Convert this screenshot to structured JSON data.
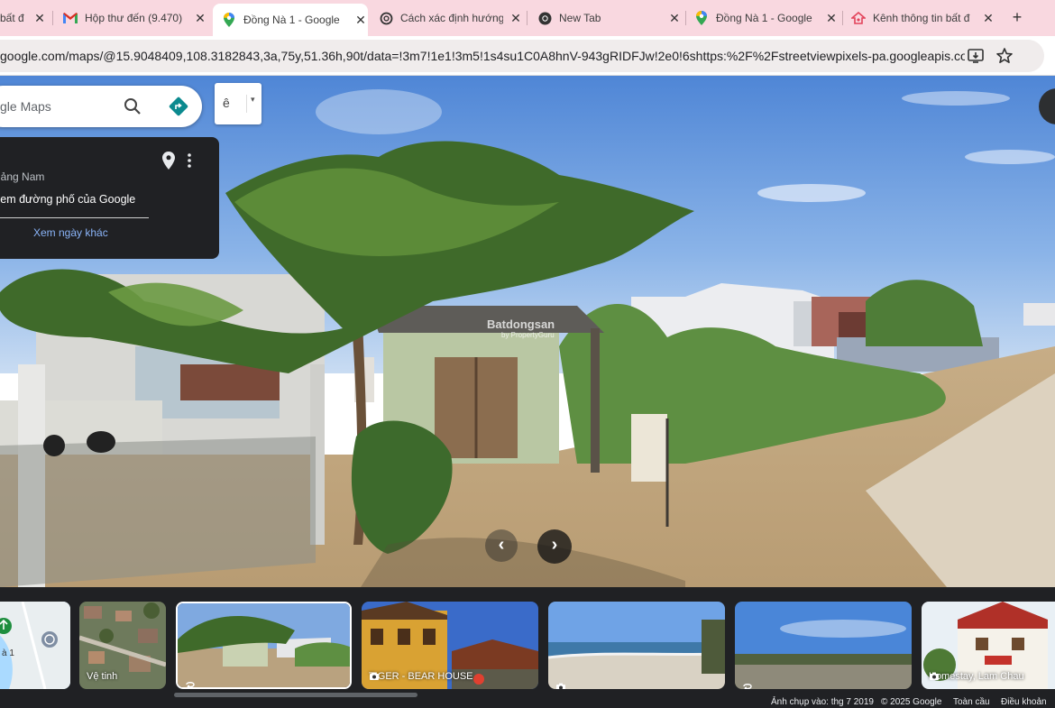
{
  "tabs": [
    {
      "title": "bất đ",
      "icon": "real-estate-icon",
      "active": false
    },
    {
      "title": "Hộp thư đến (9.470)",
      "icon": "gmail-icon",
      "active": false
    },
    {
      "title": "Đồng Nà 1 - Google",
      "icon": "google-maps-icon",
      "active": true
    },
    {
      "title": "Cách xác định hướng",
      "icon": "openai-icon",
      "active": false
    },
    {
      "title": "New Tab",
      "icon": "chrome-icon",
      "active": false
    },
    {
      "title": "Đồng Nà 1 - Google",
      "icon": "google-maps-icon",
      "active": false
    },
    {
      "title": "Kênh thông tin bất đ",
      "icon": "real-estate-icon",
      "active": false
    }
  ],
  "new_tab_label": "+",
  "address": {
    "url": "google.com/maps/@15.9048409,108.3182843,3a,75y,51.36h,90t/data=!3m7!1e1!3m5!1s4su1C0A8hnV-943gRIDFJw!2e0!6shttps:%2F%2Fstreetviewpixels-pa.googleapis.com%2Fv1%2..."
  },
  "search": {
    "placeholder": "gle Maps"
  },
  "layer_button": {
    "glyph": "ê",
    "caret": "▾"
  },
  "info_panel": {
    "region": "uảng Nam",
    "caption": "xem đường phố của Google",
    "link": "Xem ngày khác"
  },
  "watermark": {
    "brand": "Batdongsan",
    "sub": "by PropertyGuru"
  },
  "navigation": {
    "back": "‹",
    "forward": "›"
  },
  "filmstrip": [
    {
      "label": "",
      "type": "map"
    },
    {
      "label": "Vệ tinh",
      "type": "satellite"
    },
    {
      "label": "",
      "type": "street-view",
      "selected": true
    },
    {
      "label": "TIGER - BEAR HOUSE",
      "type": "photo"
    },
    {
      "label": "",
      "type": "photo"
    },
    {
      "label": "",
      "type": "street-view"
    },
    {
      "label": "Homestay, Lam Chau",
      "type": "photo"
    }
  ],
  "map_thumb_text": "à 1",
  "footer": {
    "capture_date": "Ảnh chụp vào: thg 7 2019",
    "copyright": "© 2025 Google",
    "scope": "Toàn cầu",
    "terms": "Điều khoản"
  },
  "colors": {
    "tab_strip": "#f9d8e0",
    "panel_dark": "#202124",
    "link_blue": "#8ab4f8",
    "directions_teal": "#0b8a8f"
  }
}
